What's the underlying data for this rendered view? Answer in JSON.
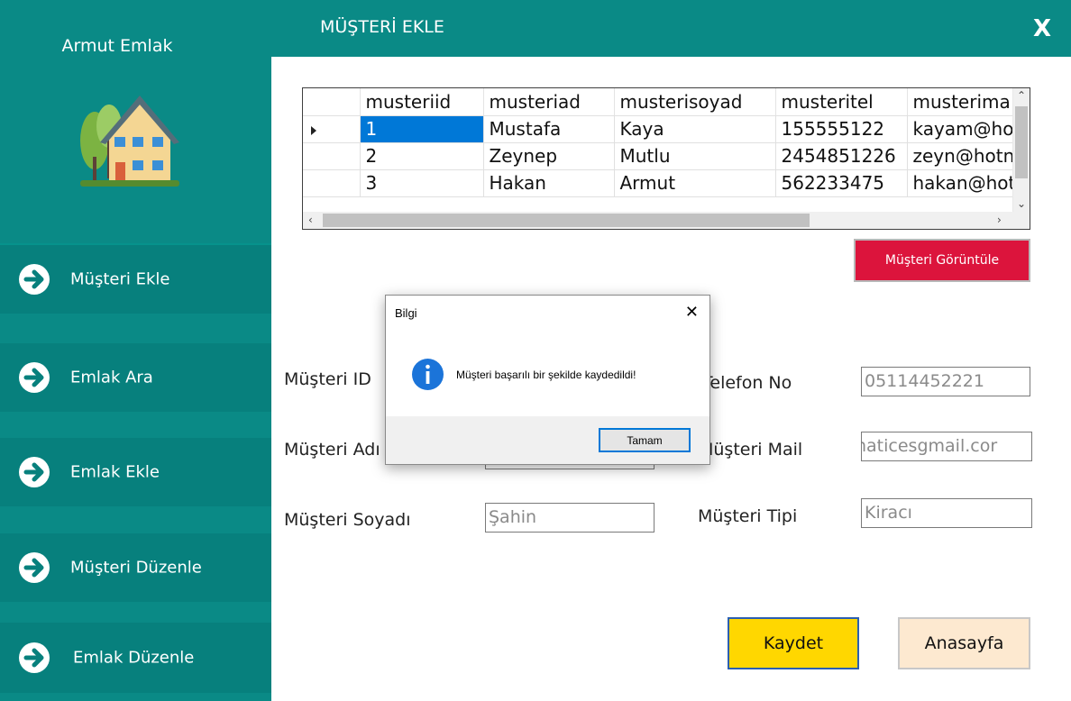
{
  "app": {
    "brand": "Armut Emlak"
  },
  "sidebar": {
    "items": [
      {
        "label": "Müşteri Ekle",
        "icon": "arrow-right-circle-icon"
      },
      {
        "label": "Emlak Ara",
        "icon": "arrow-right-circle-icon"
      },
      {
        "label": "Emlak Ekle",
        "icon": "arrow-right-circle-icon"
      },
      {
        "label": "Müşteri Düzenle",
        "icon": "arrow-right-circle-icon"
      },
      {
        "label": "Emlak Düzenle",
        "icon": "arrow-right-circle-icon"
      }
    ]
  },
  "header": {
    "title": "MÜŞTERİ EKLE",
    "close": "X"
  },
  "grid": {
    "columns": [
      "musteriid",
      "musteriad",
      "musterisoyad",
      "musteritel",
      "musterima"
    ],
    "rows": [
      [
        "1",
        "Mustafa",
        "Kaya",
        "155555122",
        "kayam@ho"
      ],
      [
        "2",
        "Zeynep",
        "Mutlu",
        "2454851226",
        "zeyn@hotn"
      ],
      [
        "3",
        "Hakan",
        "Armut",
        "562233475",
        "hakan@hot"
      ]
    ],
    "selected_row": 0
  },
  "view_button": "Müşteri Görüntüle",
  "form": {
    "id_label": "Müşteri ID",
    "name_label": "Müşteri Adı",
    "surname_label": "Müşteri Soyadı",
    "surname_value": "Şahin",
    "phone_label": "Telefon No",
    "phone_value": "05114452221",
    "mail_label": "Müşteri Mail",
    "mail_value": "naticesgmail.cor",
    "type_label": "Müşteri Tipi",
    "type_value": "Kiracı"
  },
  "buttons": {
    "save": "Kaydet",
    "home": "Anasayfa"
  },
  "dialog": {
    "title": "Bilgi",
    "message": "Müşteri başarılı bir şekilde kaydedildi!",
    "ok": "Tamam"
  },
  "colors": {
    "teal": "#0a8a86",
    "selection": "#0078d7",
    "danger": "#dc143c",
    "save": "#ffd700"
  }
}
